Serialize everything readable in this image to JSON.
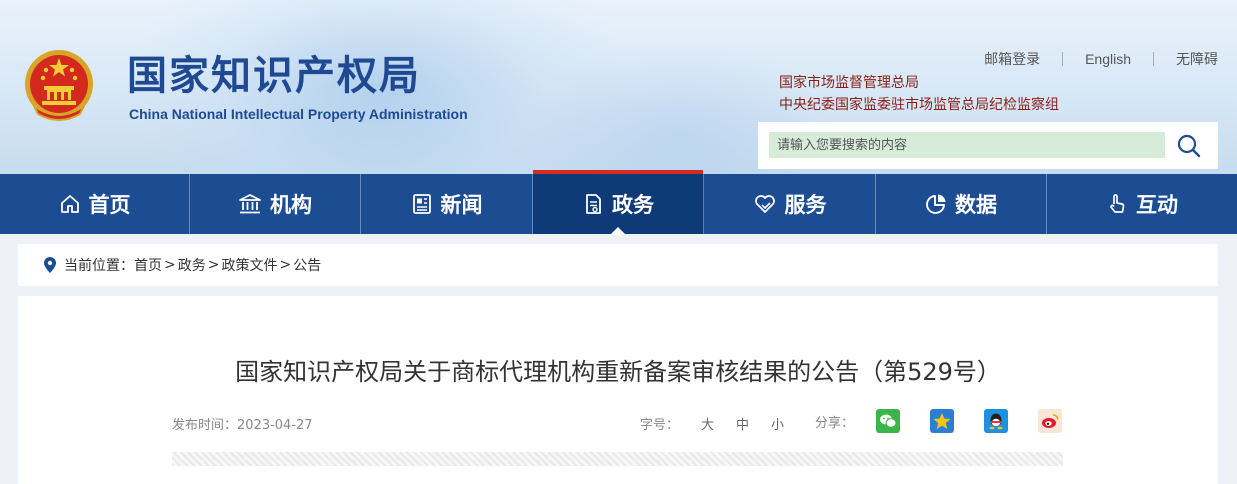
{
  "header": {
    "logo_cn": "国家知识产权局",
    "logo_en": "China National Intellectual Property Administration",
    "top_links": [
      "邮箱登录",
      "English",
      "无障碍"
    ],
    "org_links": [
      "国家市场监督管理总局",
      "中央纪委国家监委驻市场监管总局纪检监察组"
    ],
    "search_placeholder": "请输入您要搜索的内容"
  },
  "nav": {
    "items": [
      {
        "label": "首页",
        "icon": "home-icon"
      },
      {
        "label": "机构",
        "icon": "institution-icon"
      },
      {
        "label": "新闻",
        "icon": "news-icon"
      },
      {
        "label": "政务",
        "icon": "document-icon"
      },
      {
        "label": "服务",
        "icon": "heart-hand-icon"
      },
      {
        "label": "数据",
        "icon": "pie-chart-icon"
      },
      {
        "label": "互动",
        "icon": "hand-pointer-icon"
      }
    ],
    "active": "政务"
  },
  "breadcrumb": {
    "label": "当前位置：",
    "items": [
      "首页",
      "政务",
      "政策文件",
      "公告"
    ],
    "separator": ">"
  },
  "article": {
    "title": "国家知识产权局关于商标代理机构重新备案审核结果的公告（第529号）",
    "publish_label": "发布时间：",
    "publish_date": "2023-04-27",
    "font_label": "字号：",
    "font_options": [
      "大",
      "中",
      "小"
    ],
    "share_label": "分享：",
    "share_icons": [
      "wechat-icon",
      "qzone-icon",
      "qq-icon",
      "weibo-icon"
    ]
  },
  "colors": {
    "nav_bg": "#1c4d93",
    "nav_active_bg": "#0f3a78",
    "active_indicator": "#d82c20",
    "logo_blue": "#1f4a93",
    "org_red": "#8b1d14",
    "search_bg": "#d6ecd9"
  }
}
